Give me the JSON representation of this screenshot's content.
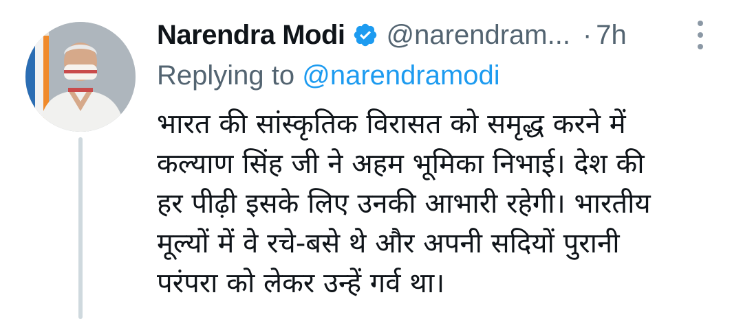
{
  "tweet": {
    "author_name": "Narendra Modi",
    "handle": "@narendram...",
    "separator": "·",
    "timestamp": "7h",
    "replying_prefix": "Replying to",
    "replying_handle": "@narendramodi",
    "verified": true,
    "body_lines": [
      "भारत की सांस्कृतिक विरासत को समृद्ध करने में",
      "कल्याण सिंह जी ने अहम भूमिका निभाई। देश की",
      "हर पीढ़ी इसके लिए उनकी आभारी रहेगी। भारतीय",
      "मूल्यों में वे रचे-बसे थे और अपनी सदियों पुरानी",
      "परंपरा को लेकर उन्हें गर्व था।"
    ]
  },
  "icons": {
    "verified": "verified-badge-icon",
    "more": "more-vertical-icon"
  },
  "colors": {
    "verified_blue": "#1d9bf0",
    "mention_blue": "#1d9bf0",
    "secondary_text": "#536471",
    "primary_text": "#0f1419",
    "thread_line": "#cfd9de"
  }
}
